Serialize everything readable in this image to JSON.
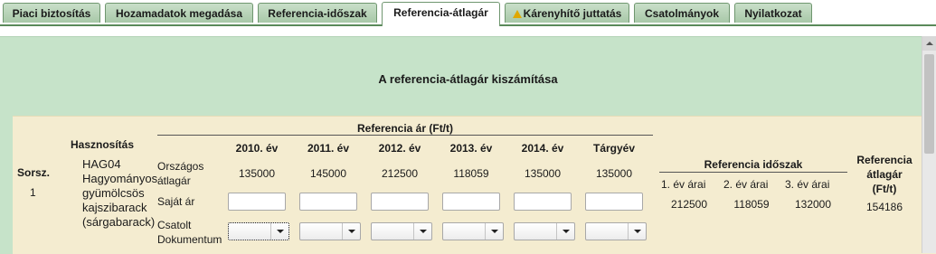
{
  "tabs": [
    {
      "label": "Piaci biztosítás",
      "active": false
    },
    {
      "label": "Hozamadatok megadása",
      "active": false
    },
    {
      "label": "Referencia-időszak",
      "active": false
    },
    {
      "label": "Referencia-átlagár",
      "active": true
    },
    {
      "label": "Kárenyhítő juttatás",
      "active": false,
      "icon": "warning-icon"
    },
    {
      "label": "Csatolmányok",
      "active": false
    },
    {
      "label": "Nyilatkozat",
      "active": false
    }
  ],
  "panel_title": "A referencia-átlagár kiszámítása",
  "table": {
    "sorsz_header": "Sorsz.",
    "hasznositas_header": "Hasznosítás",
    "referencia_ar_header": "Referencia ár (Ft/t)",
    "year_headers": [
      "2010. év",
      "2011. év",
      "2012. év",
      "2013. év",
      "2014. év",
      "Tárgyév"
    ],
    "row_labels": {
      "orszagos_line1": "Országos",
      "orszagos_line2": "átlagár",
      "sajat_ar": "Saját ár",
      "csatolt_line1": "Csatolt",
      "csatolt_line2": "Dokumentum"
    },
    "row": {
      "sorsz": "1",
      "hasznositas_lines": [
        "HAG04",
        "Hagyományos",
        "gyümölcsös",
        "kajszibarack",
        "(sárgabarack)"
      ],
      "orszagos_values": [
        "135000",
        "145000",
        "212500",
        "118059",
        "135000",
        "135000"
      ],
      "sajat_ar_values": [
        "",
        "",
        "",
        "",
        "",
        ""
      ],
      "dokumentum_values": [
        "",
        "",
        "",
        "",
        "",
        ""
      ]
    },
    "referencia_idoszak": {
      "header": "Referencia időszak",
      "columns": [
        "1. év árai",
        "2. év árai",
        "3. év árai"
      ],
      "values": [
        "212500",
        "118059",
        "132000"
      ]
    },
    "referencia_atlagar": {
      "header_lines": [
        "Referencia",
        "átlagár",
        "(Ft/t)"
      ],
      "value": "154186"
    }
  }
}
